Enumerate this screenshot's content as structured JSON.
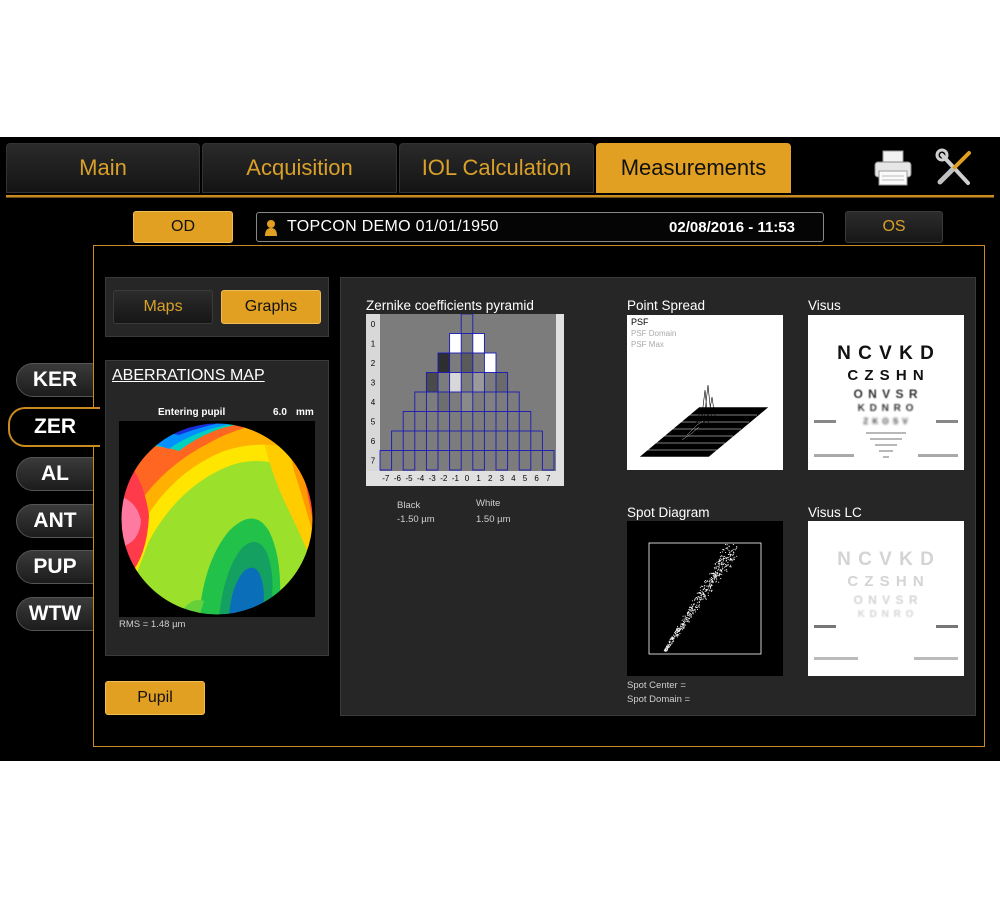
{
  "tabs": [
    {
      "label": "Main",
      "active": false
    },
    {
      "label": "Acquisition",
      "active": false
    },
    {
      "label": "IOL Calculation",
      "active": false
    },
    {
      "label": "Measurements",
      "active": true
    }
  ],
  "toolbar": {
    "print_icon": "printer-icon",
    "tools_icon": "tools-icon"
  },
  "eye_selector": {
    "od_label": "OD",
    "os_label": "OS",
    "selected": "OD"
  },
  "patient": {
    "name": "TOPCON DEMO 01/01/1950",
    "datetime": "02/08/2016 - 11:53",
    "icon": "person-icon"
  },
  "side_nav": [
    {
      "label": "KER",
      "active": false
    },
    {
      "label": "ZER",
      "active": true
    },
    {
      "label": "AL",
      "active": false
    },
    {
      "label": "ANT",
      "active": false
    },
    {
      "label": "PUP",
      "active": false
    },
    {
      "label": "WTW",
      "active": false
    }
  ],
  "view_toggle": {
    "maps_label": "Maps",
    "graphs_label": "Graphs",
    "selected": "Graphs"
  },
  "aberrations_map": {
    "title": "ABERRATIONS MAP",
    "entering_pupil_label": "Entering pupil",
    "pupil_value": "6.0",
    "pupil_unit": "mm",
    "rms": "RMS = 1.48 µm"
  },
  "pupil_button": {
    "label": "Pupil"
  },
  "zernike": {
    "title": "Zernike coefficients pyramid",
    "row_labels": [
      "0",
      "1",
      "2",
      "3",
      "4",
      "5",
      "6",
      "7"
    ],
    "col_labels": [
      "-7",
      "-6",
      "-5",
      "-4",
      "-3",
      "-2",
      "-1",
      "0",
      "1",
      "2",
      "3",
      "4",
      "5",
      "6",
      "7"
    ],
    "black_label": "Black",
    "black_value": "-1.50 µm",
    "white_label": "White",
    "white_value": "1.50 µm"
  },
  "point_spread": {
    "title": "Point Spread",
    "legend": [
      "PSF",
      "PSF Domain",
      "PSF Max"
    ]
  },
  "spot_diagram": {
    "title": "Spot Diagram",
    "spot_center": "Spot Center =",
    "spot_domain": "Spot Domain ="
  },
  "visus": {
    "title": "Visus",
    "chart_rows": [
      "N C V K D",
      "C Z S H N",
      "O N V S R",
      "K D N R O",
      "Z K O S V"
    ]
  },
  "visus_lc": {
    "title": "Visus LC",
    "chart_rows": [
      "N C V K D",
      "C Z S H N",
      "O N V S R",
      "K D N R O"
    ]
  },
  "colors": {
    "accent": "#e1a022",
    "accent_border": "#c98b1f",
    "background": "#000000",
    "panel": "#262626"
  }
}
